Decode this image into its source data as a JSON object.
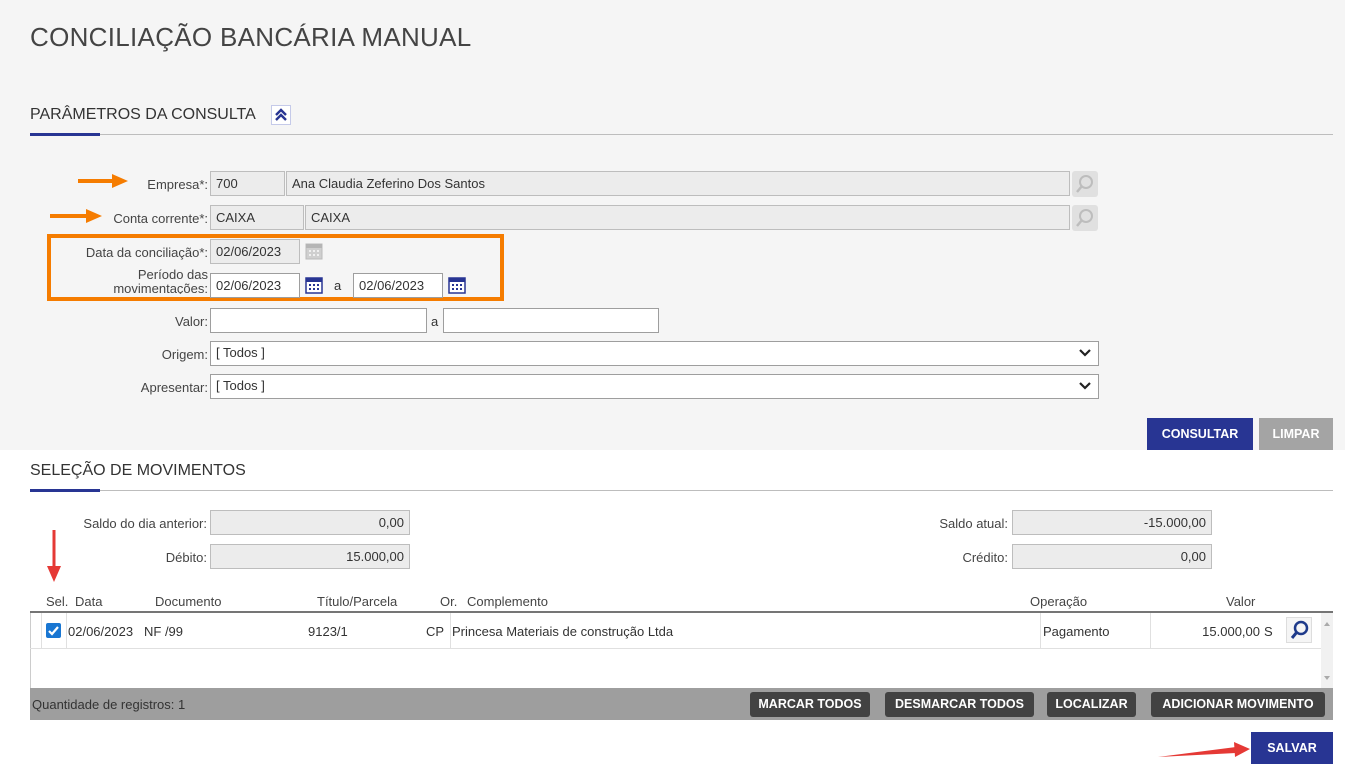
{
  "page": {
    "title": "CONCILIAÇÃO BANCÁRIA MANUAL"
  },
  "params": {
    "section_title": "PARÂMETROS DA CONSULTA",
    "empresa": {
      "label": "Empresa*:",
      "code": "700",
      "name": "Ana Claudia Zeferino Dos Santos"
    },
    "conta": {
      "label": "Conta corrente*:",
      "code": "CAIXA",
      "name": "CAIXA"
    },
    "data_conciliacao": {
      "label": "Data da conciliação*:",
      "value": "02/06/2023"
    },
    "periodo": {
      "label_line1": "Período das",
      "label_line2": "movimentações:",
      "from": "02/06/2023",
      "sep": "a",
      "to": "02/06/2023"
    },
    "valor": {
      "label": "Valor:",
      "from": "",
      "sep": "a",
      "to": ""
    },
    "origem": {
      "label": "Origem:",
      "value": "[ Todos ]"
    },
    "apresentar": {
      "label": "Apresentar:",
      "value": "[ Todos ]"
    },
    "consultar_label": "CONSULTAR",
    "limpar_label": "LIMPAR"
  },
  "selecao": {
    "section_title": "SELEÇÃO DE MOVIMENTOS",
    "saldo_anterior": {
      "label": "Saldo do dia anterior:",
      "value": "0,00"
    },
    "debito": {
      "label": "Débito:",
      "value": "15.000,00"
    },
    "saldo_atual": {
      "label": "Saldo atual:",
      "value": "-15.000,00"
    },
    "credito": {
      "label": "Crédito:",
      "value": "0,00"
    },
    "columns": {
      "sel": "Sel.",
      "data": "Data",
      "documento": "Documento",
      "titulo": "Título/Parcela",
      "or": "Or.",
      "complemento": "Complemento",
      "operacao": "Operação",
      "valor": "Valor"
    },
    "rows": [
      {
        "checked": true,
        "data": "02/06/2023",
        "documento": "NF /99",
        "titulo": "9123/1",
        "or": "CP",
        "complemento": "Princesa Materiais de construção Ltda",
        "operacao": "Pagamento",
        "valor": "15.000,00",
        "flag": "S"
      }
    ],
    "footer": {
      "count": "Quantidade de registros: 1",
      "marcar_todos": "MARCAR TODOS",
      "desmarcar_todos": "DESMARCAR TODOS",
      "localizar": "LOCALIZAR",
      "adicionar": "ADICIONAR MOVIMENTO"
    },
    "salvar_label": "SALVAR"
  },
  "colors": {
    "primary": "#283593",
    "highlight": "#f57c00",
    "arrow_red": "#e53935"
  }
}
